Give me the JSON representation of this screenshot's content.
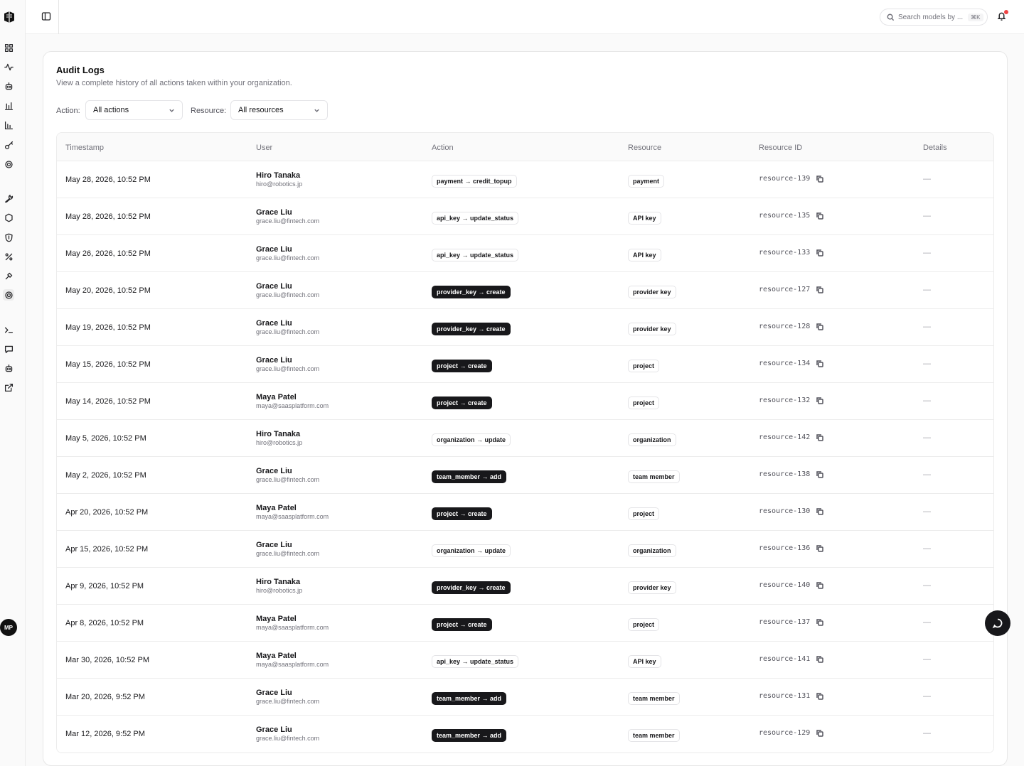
{
  "nav": {
    "avatar_initials": "MP",
    "icons": [
      "dashboard-icon",
      "activity-icon",
      "bot-icon",
      "bar-chart-icon",
      "column-chart-icon",
      "key-icon",
      "settings-icon",
      "wrench-icon",
      "hexagon-icon",
      "shield-icon",
      "percent-icon",
      "tool-icon",
      "settings-icon",
      "terminal-icon",
      "chat-icon",
      "bot-icon",
      "external-link-icon"
    ]
  },
  "header": {
    "search_placeholder": "Search models by ...",
    "search_shortcut": "⌘K"
  },
  "page": {
    "title": "Audit Logs",
    "subtitle": "View a complete history of all actions taken within your organization."
  },
  "filters": {
    "action_label": "Action:",
    "action_value": "All actions",
    "resource_label": "Resource:",
    "resource_value": "All resources"
  },
  "table": {
    "headers": [
      "Timestamp",
      "User",
      "Action",
      "Resource",
      "Resource ID",
      "Details"
    ],
    "rows": [
      {
        "timestamp": "May 28, 2026, 10:52 PM",
        "user": "Hiro Tanaka",
        "email": "hiro@robotics.jp",
        "action": "payment → credit_topup",
        "action_style": "outline",
        "resource": "payment",
        "resource_id": "resource-139",
        "details": "—"
      },
      {
        "timestamp": "May 28, 2026, 10:52 PM",
        "user": "Grace Liu",
        "email": "grace.liu@fintech.com",
        "action": "api_key → update_status",
        "action_style": "outline",
        "resource": "API key",
        "resource_id": "resource-135",
        "details": "—"
      },
      {
        "timestamp": "May 26, 2026, 10:52 PM",
        "user": "Grace Liu",
        "email": "grace.liu@fintech.com",
        "action": "api_key → update_status",
        "action_style": "outline",
        "resource": "API key",
        "resource_id": "resource-133",
        "details": "—"
      },
      {
        "timestamp": "May 20, 2026, 10:52 PM",
        "user": "Grace Liu",
        "email": "grace.liu@fintech.com",
        "action": "provider_key → create",
        "action_style": "solid",
        "resource": "provider key",
        "resource_id": "resource-127",
        "details": "—"
      },
      {
        "timestamp": "May 19, 2026, 10:52 PM",
        "user": "Grace Liu",
        "email": "grace.liu@fintech.com",
        "action": "provider_key → create",
        "action_style": "solid",
        "resource": "provider key",
        "resource_id": "resource-128",
        "details": "—"
      },
      {
        "timestamp": "May 15, 2026, 10:52 PM",
        "user": "Grace Liu",
        "email": "grace.liu@fintech.com",
        "action": "project → create",
        "action_style": "solid",
        "resource": "project",
        "resource_id": "resource-134",
        "details": "—"
      },
      {
        "timestamp": "May 14, 2026, 10:52 PM",
        "user": "Maya Patel",
        "email": "maya@saasplatform.com",
        "action": "project → create",
        "action_style": "solid",
        "resource": "project",
        "resource_id": "resource-132",
        "details": "—"
      },
      {
        "timestamp": "May 5, 2026, 10:52 PM",
        "user": "Hiro Tanaka",
        "email": "hiro@robotics.jp",
        "action": "organization → update",
        "action_style": "outline",
        "resource": "organization",
        "resource_id": "resource-142",
        "details": "—"
      },
      {
        "timestamp": "May 2, 2026, 10:52 PM",
        "user": "Grace Liu",
        "email": "grace.liu@fintech.com",
        "action": "team_member → add",
        "action_style": "solid",
        "resource": "team member",
        "resource_id": "resource-138",
        "details": "—"
      },
      {
        "timestamp": "Apr 20, 2026, 10:52 PM",
        "user": "Maya Patel",
        "email": "maya@saasplatform.com",
        "action": "project → create",
        "action_style": "solid",
        "resource": "project",
        "resource_id": "resource-130",
        "details": "—"
      },
      {
        "timestamp": "Apr 15, 2026, 10:52 PM",
        "user": "Grace Liu",
        "email": "grace.liu@fintech.com",
        "action": "organization → update",
        "action_style": "outline",
        "resource": "organization",
        "resource_id": "resource-136",
        "details": "—"
      },
      {
        "timestamp": "Apr 9, 2026, 10:52 PM",
        "user": "Hiro Tanaka",
        "email": "hiro@robotics.jp",
        "action": "provider_key → create",
        "action_style": "solid",
        "resource": "provider key",
        "resource_id": "resource-140",
        "details": "—"
      },
      {
        "timestamp": "Apr 8, 2026, 10:52 PM",
        "user": "Maya Patel",
        "email": "maya@saasplatform.com",
        "action": "project → create",
        "action_style": "solid",
        "resource": "project",
        "resource_id": "resource-137",
        "details": "—"
      },
      {
        "timestamp": "Mar 30, 2026, 10:52 PM",
        "user": "Maya Patel",
        "email": "maya@saasplatform.com",
        "action": "api_key → update_status",
        "action_style": "outline",
        "resource": "API key",
        "resource_id": "resource-141",
        "details": "—"
      },
      {
        "timestamp": "Mar 20, 2026, 9:52 PM",
        "user": "Grace Liu",
        "email": "grace.liu@fintech.com",
        "action": "team_member → add",
        "action_style": "solid",
        "resource": "team member",
        "resource_id": "resource-131",
        "details": "—"
      },
      {
        "timestamp": "Mar 12, 2026, 9:52 PM",
        "user": "Grace Liu",
        "email": "grace.liu@fintech.com",
        "action": "team_member → add",
        "action_style": "solid",
        "resource": "team member",
        "resource_id": "resource-129",
        "details": "—"
      }
    ]
  }
}
